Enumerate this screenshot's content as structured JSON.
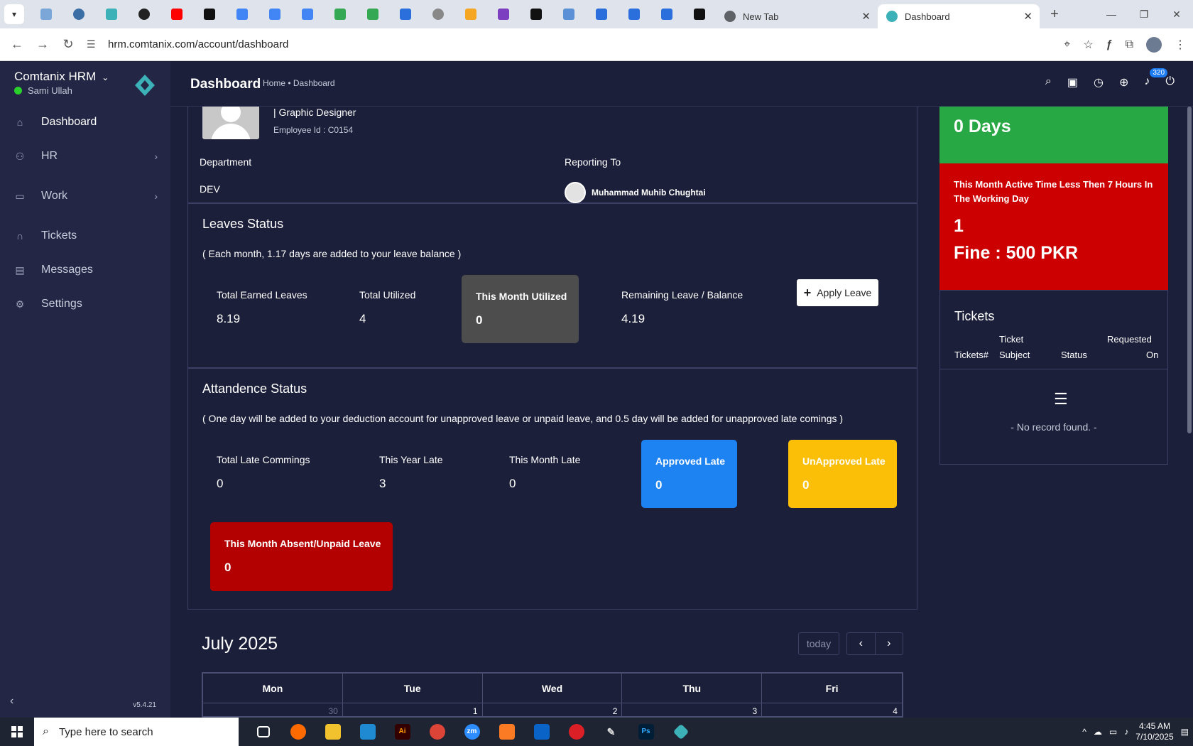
{
  "browser": {
    "tabs": [
      {
        "title": "New Tab",
        "active": false
      },
      {
        "title": "Dashboard",
        "active": true
      }
    ],
    "url": "hrm.comtanix.com/account/dashboard"
  },
  "sidebar": {
    "brand": "Comtanix HRM",
    "user": "Sami Ullah",
    "items": [
      {
        "label": "Dashboard",
        "icon": "home-icon"
      },
      {
        "label": "HR",
        "icon": "users-icon"
      },
      {
        "label": "Work",
        "icon": "briefcase-icon"
      },
      {
        "label": "Tickets",
        "icon": "headset-icon"
      },
      {
        "label": "Messages",
        "icon": "message-icon"
      },
      {
        "label": "Settings",
        "icon": "gear-icon"
      }
    ],
    "version": "v5.4.21"
  },
  "topbar": {
    "title": "Dashboard",
    "breadcrumb": "Home • Dashboard",
    "notifications": "320"
  },
  "profile": {
    "role": "| Graphic Designer",
    "employee_id": "Employee Id : C0154",
    "department_label": "Department",
    "department": "DEV",
    "reporting_label": "Reporting To",
    "reporting_to": "Muhammad Muhib Chughtai"
  },
  "leaves": {
    "title": "Leaves Status",
    "note": "( Each month, 1.17 days are added to your leave balance )",
    "total_earned_label": "Total Earned Leaves",
    "total_earned": "8.19",
    "total_utilized_label": "Total Utilized",
    "total_utilized": "4",
    "this_month_label": "This Month Utilized",
    "this_month": "0",
    "remaining_label": "Remaining Leave / Balance",
    "remaining": "4.19",
    "apply_label": "Apply Leave"
  },
  "attendance": {
    "title": "Attandence Status",
    "note": "( One day will be added to your deduction account for unapproved leave or unpaid leave, and 0.5 day will be added for unapproved late comings )",
    "total_late_label": "Total Late Commings",
    "total_late": "0",
    "year_late_label": "This Year Late",
    "year_late": "3",
    "month_late_label": "This Month Late",
    "month_late": "0",
    "approved_label": "Approved Late",
    "approved": "0",
    "unapproved_label": "UnApproved Late",
    "unapproved": "0",
    "absent_label": "This Month Absent/Unpaid Leave",
    "absent": "0"
  },
  "calendar": {
    "title": "July 2025",
    "today_label": "today",
    "headers": [
      "Mon",
      "Tue",
      "Wed",
      "Thu",
      "Fri"
    ],
    "days": [
      "30",
      "1",
      "2",
      "3",
      "4"
    ]
  },
  "right": {
    "days_value": "0 Days",
    "active_time_text": "This Month Active Time Less Then 7 Hours In The Working Day",
    "active_count": "1",
    "fine": "Fine : 500 PKR",
    "tickets_title": "Tickets",
    "col_ticket": "Tickets#",
    "col_subject_1": "Ticket",
    "col_subject_2": "Subject",
    "col_status": "Status",
    "col_requested_1": "Requested",
    "col_requested_2": "On",
    "no_record": "- No record found. -"
  },
  "taskbar": {
    "search_placeholder": "Type here to search",
    "time": "4:45 AM",
    "date": "7/10/2025"
  }
}
